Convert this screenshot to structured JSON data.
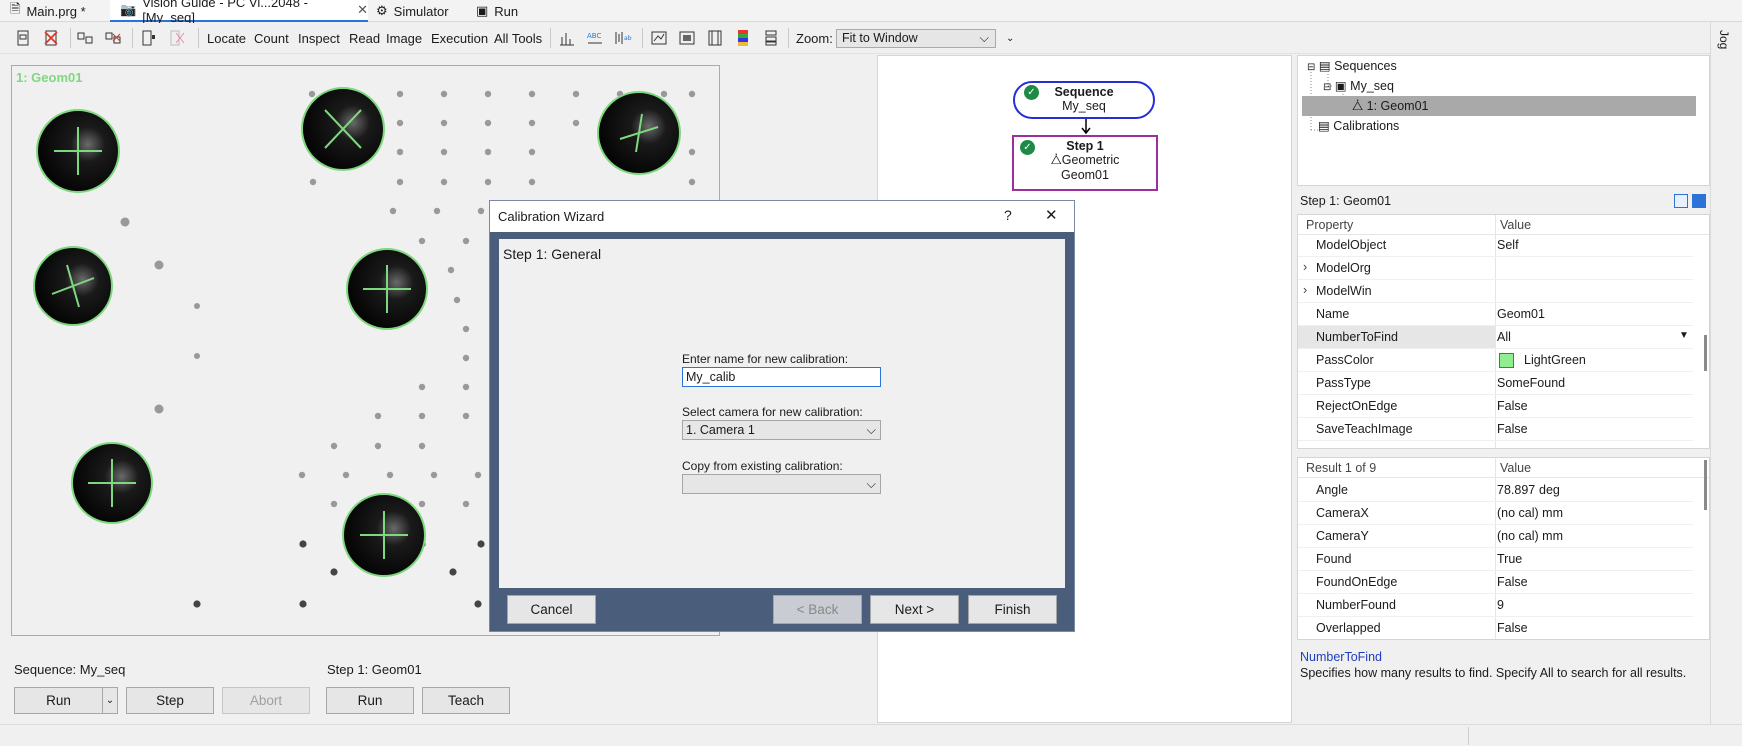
{
  "tabs": [
    {
      "label": "Main.prg *"
    },
    {
      "label": "Vision Guide - PC Vi...2048 - [My_seq]"
    },
    {
      "label": "Simulator"
    },
    {
      "label": "Run"
    }
  ],
  "toolbar": {
    "items": [
      "Locate",
      "Count",
      "Inspect",
      "Read",
      "Image",
      "Execution",
      "All Tools"
    ],
    "zoom_label": "Zoom:",
    "zoom_value": "Fit to Window"
  },
  "image": {
    "title": "1: Geom01"
  },
  "sequence_controls": {
    "label": "Sequence: My_seq",
    "run": "Run",
    "step": "Step",
    "abort": "Abort"
  },
  "step_controls": {
    "label": "Step 1: Geom01",
    "run": "Run",
    "teach": "Teach"
  },
  "flow": {
    "seq_title": "Sequence",
    "seq_name": "My_seq",
    "step_title": "Step 1",
    "step_type": "Geometric",
    "step_name": "Geom01"
  },
  "tree": {
    "items": [
      "Sequences",
      "My_seq",
      "1: Geom01",
      "Calibrations"
    ]
  },
  "properties": {
    "title": "Step 1: Geom01",
    "col_property": "Property",
    "col_value": "Value",
    "rows": [
      {
        "k": "ModelObject",
        "v": "Self"
      },
      {
        "k": "ModelOrg",
        "v": ""
      },
      {
        "k": "ModelWin",
        "v": ""
      },
      {
        "k": "Name",
        "v": "Geom01"
      },
      {
        "k": "NumberToFind",
        "v": "All"
      },
      {
        "k": "PassColor",
        "v": "LightGreen"
      },
      {
        "k": "PassType",
        "v": "SomeFound"
      },
      {
        "k": "RejectOnEdge",
        "v": "False"
      },
      {
        "k": "SaveTeachImage",
        "v": "False"
      }
    ],
    "passcolor_swatch": "#90ee90"
  },
  "results": {
    "col_result": "Result 1 of 9",
    "col_value": "Value",
    "rows": [
      {
        "k": "Angle",
        "v": "78.897",
        "u": "deg"
      },
      {
        "k": "CameraX",
        "v": "(no cal) mm",
        "u": ""
      },
      {
        "k": "CameraY",
        "v": "(no cal) mm",
        "u": ""
      },
      {
        "k": "Found",
        "v": "True",
        "u": ""
      },
      {
        "k": "FoundOnEdge",
        "v": "False",
        "u": ""
      },
      {
        "k": "NumberFound",
        "v": "9",
        "u": ""
      },
      {
        "k": "Overlapped",
        "v": "False",
        "u": ""
      }
    ]
  },
  "help": {
    "title": "NumberToFind",
    "text": "Specifies how many results to find.  Specify All to search for all results."
  },
  "side_tab": "Jog",
  "dialog": {
    "title": "Calibration Wizard",
    "help": "?",
    "close": "✕",
    "step_label": "Step 1: General",
    "name_label": "Enter name for new calibration:",
    "name_value": "My_calib",
    "camera_label": "Select camera for new calibration:",
    "camera_value": "1. Camera 1",
    "copy_label": "Copy from existing calibration:",
    "copy_value": "",
    "cancel": "Cancel",
    "back": "< Back",
    "next": "Next >",
    "finish": "Finish"
  },
  "colors": {
    "accent": "#2b73d6",
    "pass_green": "#7ed87e",
    "dialog_frame": "#4a5d7a",
    "sequence_node": "#2430d6",
    "step_node": "#9b2f9b",
    "help_title": "#1f3fbf",
    "tree_selection": "#a9a9a9"
  }
}
